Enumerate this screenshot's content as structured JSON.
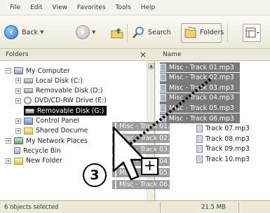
{
  "menu": [
    "File",
    "Edit",
    "View",
    "Favorites",
    "Tools",
    "Help"
  ],
  "toolbar": {
    "back_label": "Back",
    "search_label": "Search",
    "folders_label": "Folders"
  },
  "folders_pane": {
    "title": "Folders",
    "close_glyph": "×",
    "tree": [
      {
        "label": "My Computer",
        "expander": "−",
        "icon": "computer-icon",
        "selected": false
      },
      {
        "label": "Local Disk (C:)",
        "expander": "+",
        "icon": "drive-icon",
        "selected": false
      },
      {
        "label": "Removable Disk (D:)",
        "expander": "+",
        "icon": "drive-icon",
        "selected": false
      },
      {
        "label": "DVD/CD-RW Drive (E:)",
        "expander": "+",
        "icon": "cd-drive-icon",
        "selected": false
      },
      {
        "label": "Removable Disk (G:)",
        "expander": "",
        "icon": "drive-icon",
        "selected": true
      },
      {
        "label": "Control Panel",
        "expander": "+",
        "icon": "control-panel-icon",
        "selected": false
      },
      {
        "label": "Shared Docume",
        "expander": "+",
        "icon": "folder-icon",
        "selected": false
      },
      {
        "label": "My Network Places",
        "expander": "+",
        "icon": "network-icon",
        "selected": false
      },
      {
        "label": "Recycle Bin",
        "expander": "",
        "icon": "recycle-bin-icon",
        "selected": false
      },
      {
        "label": "New Folder",
        "expander": "+",
        "icon": "folder-icon",
        "selected": false
      }
    ]
  },
  "files_pane": {
    "column_name": "Name",
    "files": [
      {
        "name": "Misc - Track 01.mp3",
        "selected": true
      },
      {
        "name": "Misc - Track 02.mp3",
        "selected": true
      },
      {
        "name": "Misc - Track 03.mp3",
        "selected": true
      },
      {
        "name": "Misc - Track 04.mp3",
        "selected": true
      },
      {
        "name": "Misc - Track 05.mp3",
        "selected": true
      },
      {
        "name": "Misc - Track 06.mp3",
        "selected": true
      },
      {
        "name": "Track 07.mp3",
        "selected": false
      },
      {
        "name": "Track 08.mp3",
        "selected": false
      },
      {
        "name": "Track 09.mp3",
        "selected": false
      },
      {
        "name": "Track 10.mp3",
        "selected": false
      }
    ]
  },
  "drag_ghost": [
    "Misc - Track 01.mp3",
    "Misc - Track 02.mp3",
    "Misc - Track 03.mp3",
    "Misc - Track 04.mp3",
    "Misc - Track 05.mp3",
    "Misc - Track 06.mp3"
  ],
  "status": {
    "left": "6 objects selected",
    "right": "21.5 MB"
  },
  "annotation": {
    "step": "3",
    "plus": "+"
  },
  "colors": {
    "selection": "#0a0a0a",
    "file_selection": "#7a7a7a",
    "chrome": "#ece9d8"
  }
}
